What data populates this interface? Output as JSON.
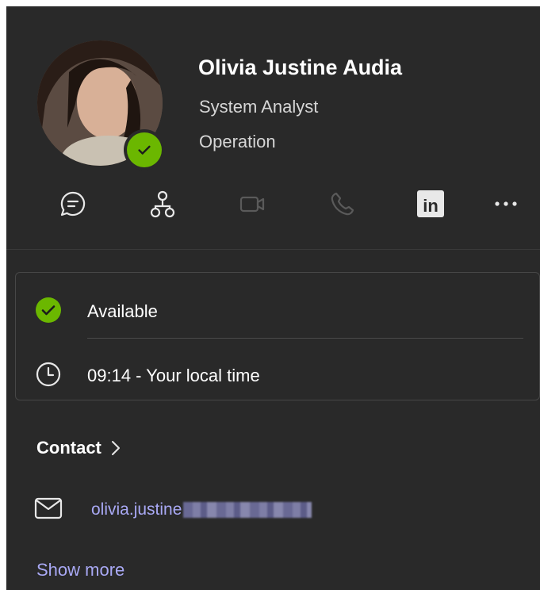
{
  "profile": {
    "name": "Olivia Justine Audia",
    "job_title": "System Analyst",
    "department": "Operation",
    "presence": "available"
  },
  "actions": [
    {
      "icon": "chat-icon",
      "enabled": true
    },
    {
      "icon": "org-chart-icon",
      "enabled": true
    },
    {
      "icon": "video-call-icon",
      "enabled": false
    },
    {
      "icon": "phone-call-icon",
      "enabled": false
    },
    {
      "icon": "linkedin-icon",
      "enabled": true
    },
    {
      "icon": "more-options-icon",
      "enabled": true
    }
  ],
  "status": {
    "availability": "Available",
    "local_time": "09:14 - Your local time"
  },
  "contact": {
    "heading": "Contact",
    "email_visible": "olivia.justine",
    "show_more": "Show more"
  },
  "colors": {
    "background": "#292929",
    "presence_green": "#6bb700",
    "link": "#a9a9f5",
    "disabled_icon": "#5a5a5a"
  }
}
